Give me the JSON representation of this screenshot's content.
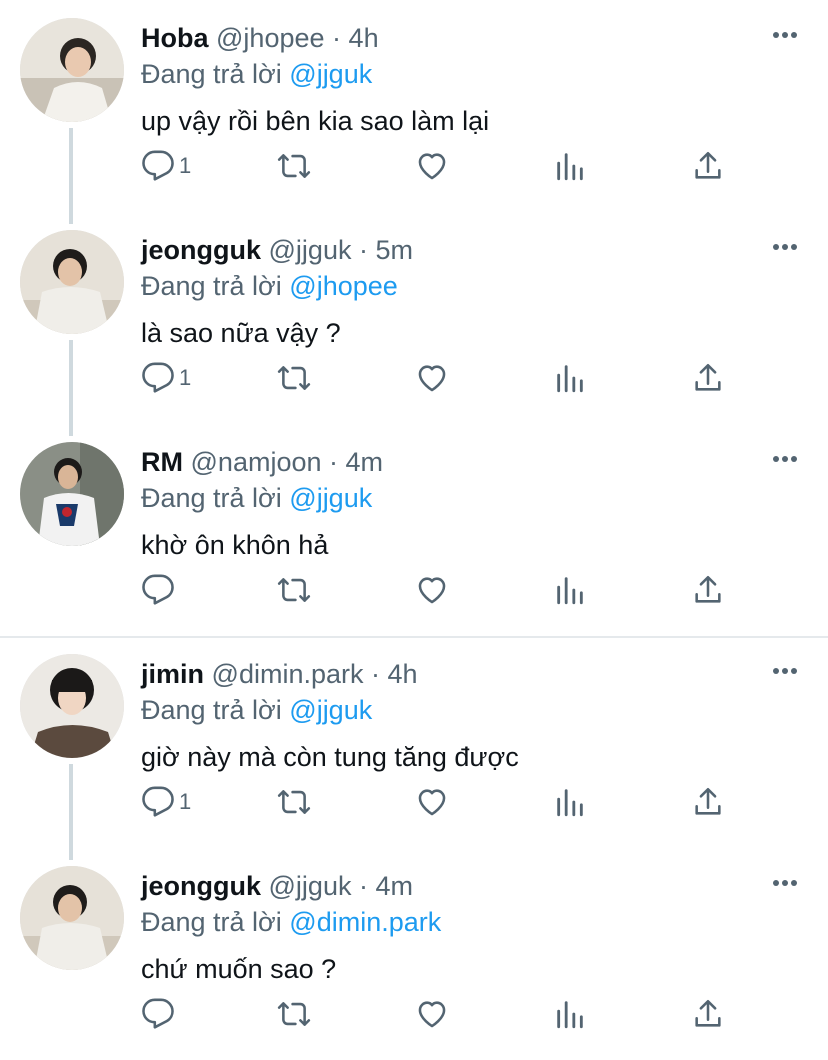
{
  "colors": {
    "accent": "#1d9bf0",
    "secondary": "#536471",
    "text": "#0f1419",
    "thread_line": "#cfd9de"
  },
  "reply_prefix": "Đang trả lời",
  "tweets": [
    {
      "name": "Hoba",
      "handle": "@jhopee",
      "dot": "·",
      "time": "4h",
      "reply_to": "@jjguk",
      "text": "up vậy rồi bên kia sao làm lại",
      "reply_count": "1"
    },
    {
      "name": "jeongguk",
      "handle": "@jjguk",
      "dot": "·",
      "time": "5m",
      "reply_to": "@jhopee",
      "text": "là sao nữa vậy ?",
      "reply_count": "1"
    },
    {
      "name": "RM",
      "handle": "@namjoon",
      "dot": "·",
      "time": "4m",
      "reply_to": "@jjguk",
      "text": "khờ ôn khôn hả",
      "reply_count": ""
    },
    {
      "name": "jimin",
      "handle": "@dimin.park",
      "dot": "·",
      "time": "4h",
      "reply_to": "@jjguk",
      "text": "giờ này mà còn tung tăng được",
      "reply_count": "1"
    },
    {
      "name": "jeongguk",
      "handle": "@jjguk",
      "dot": "·",
      "time": "4m",
      "reply_to": "@dimin.park",
      "text": "chứ muốn sao ?",
      "reply_count": ""
    }
  ],
  "icons": [
    "more-icon",
    "reply-icon",
    "retweet-icon",
    "like-icon",
    "views-icon",
    "share-icon"
  ]
}
